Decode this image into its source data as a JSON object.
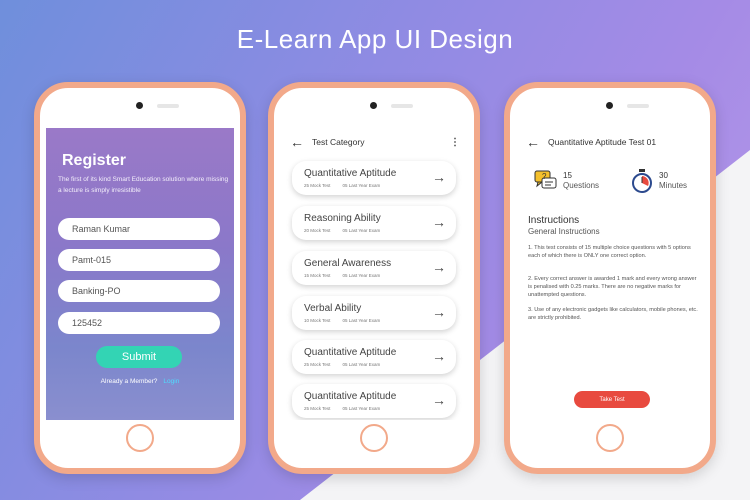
{
  "page_title": "E-Learn App UI Design",
  "register": {
    "title": "Register",
    "subtitle": "The first of its kind Smart Education solution where missing a lecture is simply irresistible",
    "fields": [
      {
        "value": "Raman Kumar"
      },
      {
        "value": "Pamt-015"
      },
      {
        "value": "Banking-PO"
      },
      {
        "value": "125452"
      }
    ],
    "submit_label": "Submit",
    "member_text": "Already a Member?",
    "login_label": "Login"
  },
  "category": {
    "header_title": "Test Category",
    "back_icon": "arrow-left-icon",
    "menu_icon": "kebab-menu-icon",
    "items": [
      {
        "name": "Quantitative Aptitude",
        "mock": "25 Mock Test",
        "last": "05 Last Year Exam"
      },
      {
        "name": "Reasoning Ability",
        "mock": "20 Mock Test",
        "last": "05 Last Year Exam"
      },
      {
        "name": "General Awareness",
        "mock": "15 Mock Test",
        "last": "05 Last Year Exam"
      },
      {
        "name": "Verbal Ability",
        "mock": "10 Mock Test",
        "last": "05 Last Year Exam"
      },
      {
        "name": "Quantitative Aptitude",
        "mock": "25 Mock Test",
        "last": "05 Last Year Exam"
      },
      {
        "name": "Quantitative Aptitude",
        "mock": "25 Mock Test",
        "last": "05 Last Year Exam"
      }
    ]
  },
  "detail": {
    "header_title": "Quantitative Aptitude Test 01",
    "questions_count": "15",
    "questions_label": "Questions",
    "minutes_count": "30",
    "minutes_label": "Minutes",
    "instructions_title": "Instructions",
    "instructions_sub": "General Instructions",
    "paragraphs": [
      "1. This test consists of 15 multiple choice questions with 5 options each of which there is ONLY one correct option.",
      "2. Every correct answer is awarded 1 mark and every wrong answer is penalised with 0.25 marks. There are no negative marks for unattempted questions.",
      "3. Use of any electronic gadgets like calculators, mobile phones, etc. are strictly prohibited."
    ],
    "take_test_label": "Take Test"
  },
  "colors": {
    "phone_frame": "#f2a98a",
    "submit": "#33d4b4",
    "take_test": "#e84a3f",
    "login_link": "#4fdcff"
  }
}
